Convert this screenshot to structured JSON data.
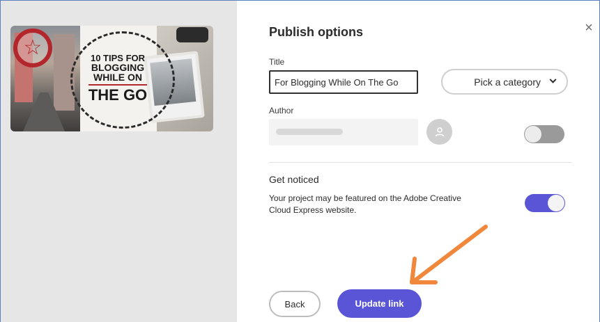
{
  "preview": {
    "thumbnail": {
      "title_lines": [
        "10 TIPS FOR",
        "BLOGGING",
        "WHILE ON",
        "THE GO"
      ],
      "badge_icon": "star-icon"
    }
  },
  "panel": {
    "title": "Publish options",
    "close_glyph": "×"
  },
  "form": {
    "title_label": "Title",
    "title_value": "For Blogging While On The Go",
    "category_label": "Pick a category",
    "author_label": "Author",
    "author_toggle_on": false
  },
  "get_noticed": {
    "heading": "Get noticed",
    "description": "Your project may be featured on the Adobe Creative Cloud Express website.",
    "toggle_on": true
  },
  "actions": {
    "back_label": "Back",
    "update_label": "Update link"
  },
  "colors": {
    "accent": "#5a55d6",
    "annotation_arrow": "#f0873a",
    "badge_red": "#b3262b"
  }
}
